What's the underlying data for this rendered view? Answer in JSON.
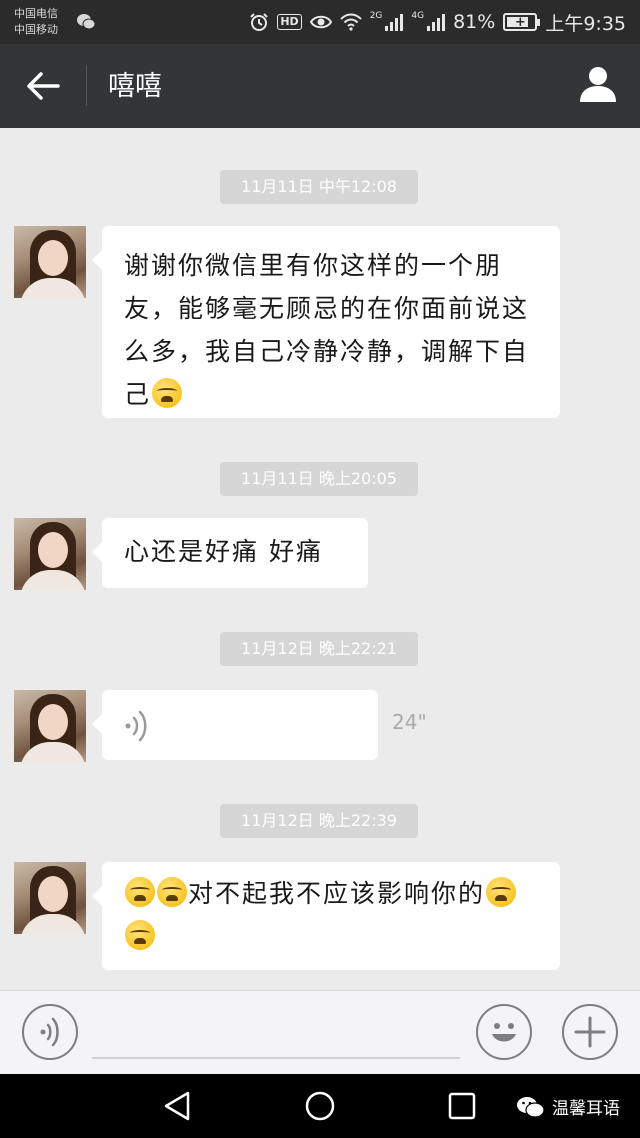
{
  "status_bar": {
    "carrier_1": "中国电信",
    "carrier_2": "中国移动",
    "network_1": "2G",
    "network_2": "4G",
    "battery_percent": "81%",
    "battery_level": 0.81,
    "time": "上午9:35"
  },
  "header": {
    "title": "嘻嘻"
  },
  "messages": [
    {
      "timestamp": "11月11日 中午12:08",
      "type": "text",
      "lines": [
        "谢谢你微信里有你这样的一个朋",
        "友，能够毫无顾忌的在你面前说这",
        "么多，我自己冷静冷静，调解下自",
        "己"
      ],
      "emoji_name": "crying-face-icon"
    },
    {
      "timestamp": "11月11日 晚上20:05",
      "type": "text",
      "text": "心还是好痛 好痛"
    },
    {
      "timestamp": "11月12日 晚上22:21",
      "type": "voice",
      "duration": "24\""
    },
    {
      "timestamp": "11月12日 晚上22:39",
      "type": "text",
      "text": "对不起我不应该影响你的",
      "emoji_name": "crying-face-icon"
    }
  ],
  "input_bar": {
    "placeholder": ""
  },
  "watermark": {
    "text": "温馨耳语"
  },
  "colors": {
    "status_bar_bg": "#2b2b2b",
    "title_bar_bg": "#333537",
    "chat_bg": "#ebebeb",
    "bubble_bg": "#ffffff",
    "timestamp_bg": "#d6d6d6"
  }
}
